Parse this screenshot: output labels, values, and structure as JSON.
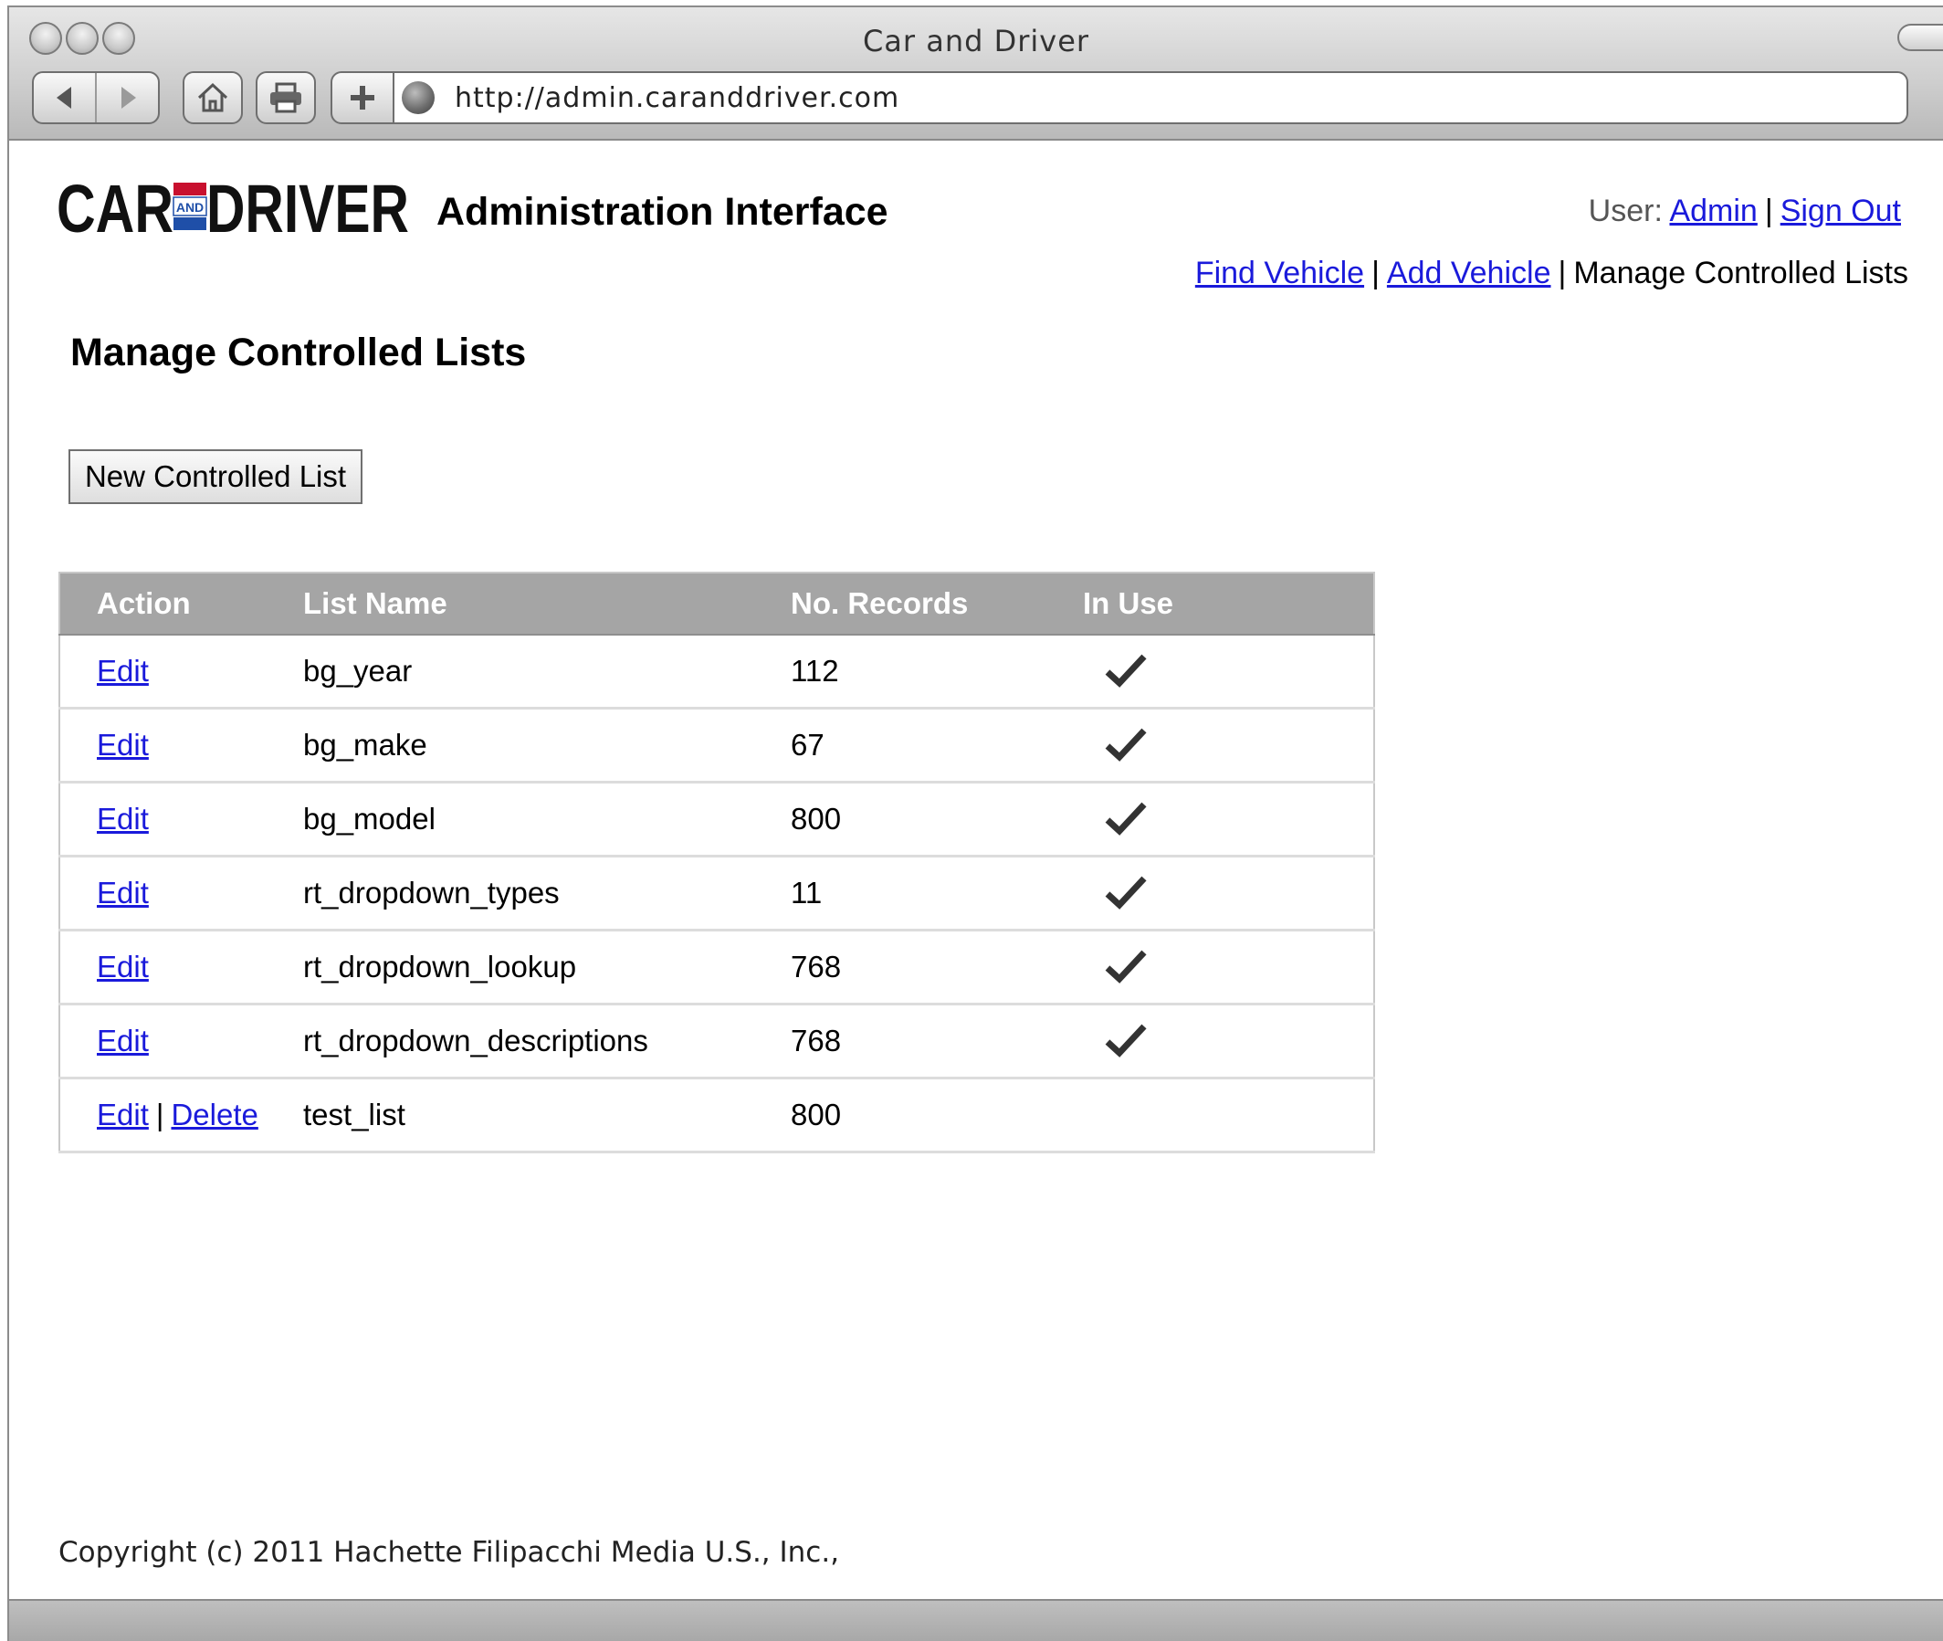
{
  "window": {
    "title": "Car and Driver",
    "url": "http://admin.caranddriver.com"
  },
  "toolbar": {
    "buttons": [
      "back-icon",
      "forward-icon",
      "home-icon",
      "print-icon",
      "add-icon",
      "globe-icon"
    ]
  },
  "header": {
    "logo_text": "CAR AND DRIVER",
    "app_title": "Administration Interface",
    "user_label": "User:",
    "user_name": "Admin",
    "sign_out": "Sign Out"
  },
  "nav": {
    "find_vehicle": "Find Vehicle",
    "add_vehicle": "Add Vehicle",
    "current": "Manage Controlled Lists",
    "separator": "|"
  },
  "page": {
    "title": "Manage Controlled Lists",
    "new_button": "New Controlled List"
  },
  "table": {
    "headers": [
      "Action",
      "List Name",
      "No. Records",
      "In Use"
    ],
    "rows": [
      {
        "actions": [
          "Edit"
        ],
        "name": "bg_year",
        "records": "112",
        "in_use": true
      },
      {
        "actions": [
          "Edit"
        ],
        "name": "bg_make",
        "records": "67",
        "in_use": true
      },
      {
        "actions": [
          "Edit"
        ],
        "name": "bg_model",
        "records": "800",
        "in_use": true
      },
      {
        "actions": [
          "Edit"
        ],
        "name": "rt_dropdown_types",
        "records": "11",
        "in_use": true
      },
      {
        "actions": [
          "Edit"
        ],
        "name": "rt_dropdown_lookup",
        "records": "768",
        "in_use": true
      },
      {
        "actions": [
          "Edit"
        ],
        "name": "rt_dropdown_descriptions",
        "records": "768",
        "in_use": true
      },
      {
        "actions": [
          "Edit",
          "Delete"
        ],
        "name": "test_list",
        "records": "800",
        "in_use": false
      }
    ]
  },
  "footer": {
    "copyright": "Copyright (c) 2011 Hachette Filipacchi Media U.S., Inc.,"
  },
  "colors": {
    "link": "#1a1adb",
    "header_bg": "#a5a5a5",
    "logo_red": "#c8102e",
    "logo_blue": "#1f4fa8"
  }
}
